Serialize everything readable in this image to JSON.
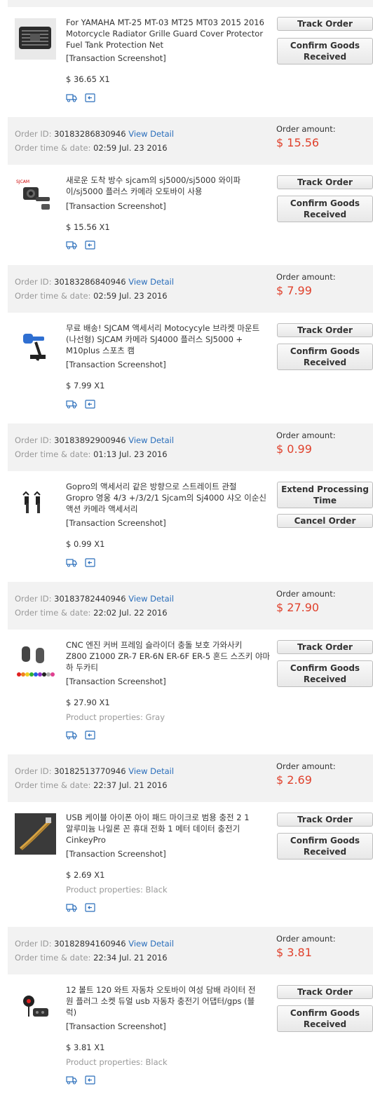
{
  "labels": {
    "order_id": "Order ID:",
    "order_time": "Order time & date:",
    "view_detail": "View Detail",
    "order_amount": "Order amount:",
    "transaction_screenshot": "[Transaction Screenshot]",
    "product_properties": "Product properties:",
    "track_order": "Track Order",
    "confirm_line1": "Confirm Goods",
    "confirm_line2": "Received",
    "extend_line1": "Extend Processing",
    "extend_line2": "Time",
    "cancel_order": "Cancel Order"
  },
  "first_item": {
    "title_lines": [
      "For YAMAHA MT-25 MT-03 MT25 MT03 2015 2016",
      "Motorcycle Radiator Grille Guard Cover Protector",
      "Fuel Tank Protection Net"
    ],
    "price": "$ 36.65 X1"
  },
  "orders": [
    {
      "order_id": "30183286830946",
      "time": "02:59 Jul. 23 2016",
      "amount": "$ 15.56",
      "title_lines": [
        "새로운 도착 방수 sjcam의 sj5000/sj5000 와이파",
        "이/sj5000 플러스 카메라 오토바이 사용"
      ],
      "price": "$ 15.56 X1",
      "properties": ""
    },
    {
      "order_id": "30183286840946",
      "time": "02:59 Jul. 23 2016",
      "amount": "$ 7.99",
      "title_lines": [
        "무료 배송! SJCAM 액세서리 Motocycyle 브라켓 마운트",
        "(나선형) SJCAM 카메라 SJ4000 플러스 SJ5000 +",
        "M10plus 스포츠 캠"
      ],
      "price": "$ 7.99 X1",
      "properties": ""
    },
    {
      "order_id": "30183892900946",
      "time": "01:13 Jul. 23 2016",
      "amount": "$ 0.99",
      "title_lines": [
        "Gopro의 액세서리 같은 방향으로 스트레이트 관절",
        "Gropro 영웅 4/3 +/3/2/1 Sjcam의 Sj4000 샤오 이순신",
        "액션 카메라 액세서리"
      ],
      "price": "$ 0.99 X1",
      "properties": ""
    },
    {
      "order_id": "30183782440946",
      "time": "22:02 Jul. 22 2016",
      "amount": "$ 27.90",
      "title_lines": [
        "CNC 엔진 커버 프레임 슬라이더 충돌 보호 가와사키",
        "Z800 Z1000 ZR-7 ER-6N ER-6F ER-5 혼드 스즈키 야마",
        "하 두카티"
      ],
      "price": "$ 27.90 X1",
      "properties": "Gray"
    },
    {
      "order_id": "30182513770946",
      "time": "22:37 Jul. 21 2016",
      "amount": "$ 2.69",
      "title_lines": [
        "USB 케이블 아이폰 아이 패드 마이크로 범용 충전 2 1",
        "알루미늄 나일론 꼰 휴대 전화 1 메터 데이터 충전기",
        "CinkeyPro"
      ],
      "price": "$ 2.69 X1",
      "properties": "Black"
    },
    {
      "order_id": "30182894160946",
      "time": "22:34 Jul. 21 2016",
      "amount": "$ 3.81",
      "title_lines": [
        "12 볼트 120 와트 자동차 오토바이 여성 담배 라이터 전",
        "원 플러그 소켓 듀얼 usb 자동차 충전기 어댑터/gps (블",
        "럭)"
      ],
      "price": "$ 3.81 X1",
      "properties": "Black"
    }
  ]
}
